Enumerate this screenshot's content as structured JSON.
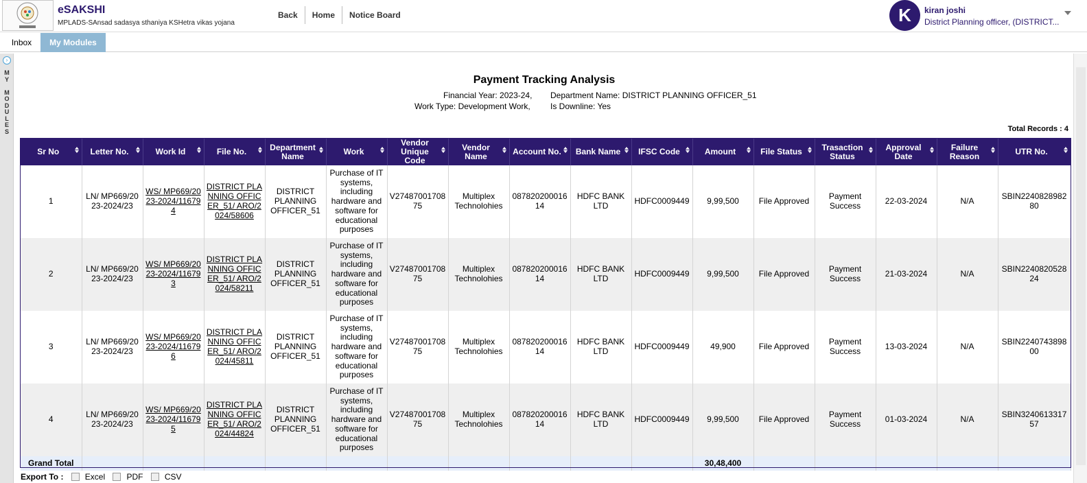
{
  "header": {
    "app_title": "eSAKSHI",
    "app_subtitle": "MPLADS-SAnsad sadasya sthaniya KSHetra vikas yojana",
    "nav": [
      "Back",
      "Home",
      "Notice Board"
    ],
    "user": {
      "initial": "K",
      "name": "kiran joshi",
      "role": "District Planning officer, (DISTRICT..."
    }
  },
  "tabs": [
    "Inbox",
    "My Modules"
  ],
  "sidebar": {
    "label": "M\nY\n \nM\nO\nD\nU\nL\nE\nS",
    "toggle_icon": "chevron-right-icon"
  },
  "report": {
    "title": "Payment Tracking Analysis",
    "financial_year": "Financial Year: 2023-24,",
    "department": "Department Name: DISTRICT PLANNING OFFICER_51",
    "work_type": "Work Type: Development Work,",
    "is_downline": "Is Downline: Yes",
    "total_records": "Total Records : 4"
  },
  "table": {
    "columns": [
      "Sr No",
      "Letter No.",
      "Work Id",
      "File No.",
      "Department Name",
      "Work",
      "Vendor Unique Code",
      "Vendor Name",
      "Account No.",
      "Bank Name",
      "IFSC Code",
      "Amount",
      "File Status",
      "Trasaction Status",
      "Approval Date",
      "Failure Reason",
      "UTR No."
    ],
    "rows": [
      [
        "1",
        "LN/ MP669/2023-2024/23",
        "WS/ MP669/2023-2024/116794",
        "DISTRICT PLANNING OFFICER_51/ ARO/2024/58606",
        "DISTRICT PLANNING OFFICER_51",
        "Purchase of IT systems, including hardware and software for educational purposes",
        "V2748700170875",
        "Multiplex Technolohies",
        "08782020001614",
        "HDFC BANK LTD",
        "HDFC0009449",
        "9,99,500",
        "File Approved",
        "Payment Success",
        "22-03-2024",
        "N/A",
        "SBIN224082898280"
      ],
      [
        "2",
        "LN/ MP669/2023-2024/23",
        "WS/ MP669/2023-2024/116793",
        "DISTRICT PLANNING OFFICER_51/ ARO/2024/58211",
        "DISTRICT PLANNING OFFICER_51",
        "Purchase of IT systems, including hardware and software for educational purposes",
        "V2748700170875",
        "Multiplex Technolohies",
        "08782020001614",
        "HDFC BANK LTD",
        "HDFC0009449",
        "9,99,500",
        "File Approved",
        "Payment Success",
        "21-03-2024",
        "N/A",
        "SBIN224082052824"
      ],
      [
        "3",
        "LN/ MP669/2023-2024/23",
        "WS/ MP669/2023-2024/116796",
        "DISTRICT PLANNING OFFICER_51/ ARO/2024/45811",
        "DISTRICT PLANNING OFFICER_51",
        "Purchase of IT systems, including hardware and software for educational purposes",
        "V2748700170875",
        "Multiplex Technolohies",
        "08782020001614",
        "HDFC BANK LTD",
        "HDFC0009449",
        "49,900",
        "File Approved",
        "Payment Success",
        "13-03-2024",
        "N/A",
        "SBIN224074389800"
      ],
      [
        "4",
        "LN/ MP669/2023-2024/23",
        "WS/ MP669/2023-2024/116795",
        "DISTRICT PLANNING OFFICER_51/ ARO/2024/44824",
        "DISTRICT PLANNING OFFICER_51",
        "Purchase of IT systems, including hardware and software for educational purposes",
        "V2748700170875",
        "Multiplex Technolohies",
        "08782020001614",
        "HDFC BANK LTD",
        "HDFC0009449",
        "9,99,500",
        "File Approved",
        "Payment Success",
        "01-03-2024",
        "N/A",
        "SBIN324061331757"
      ]
    ],
    "grand_total_label": "Grand Total",
    "grand_total_amount": "30,48,400"
  },
  "export": {
    "label": "Export To :",
    "options": [
      "Excel",
      "PDF",
      "CSV"
    ]
  },
  "colors": {
    "brand": "#2d1a6e",
    "tab_active": "#8fb8d4",
    "row_alt": "#efefef"
  }
}
